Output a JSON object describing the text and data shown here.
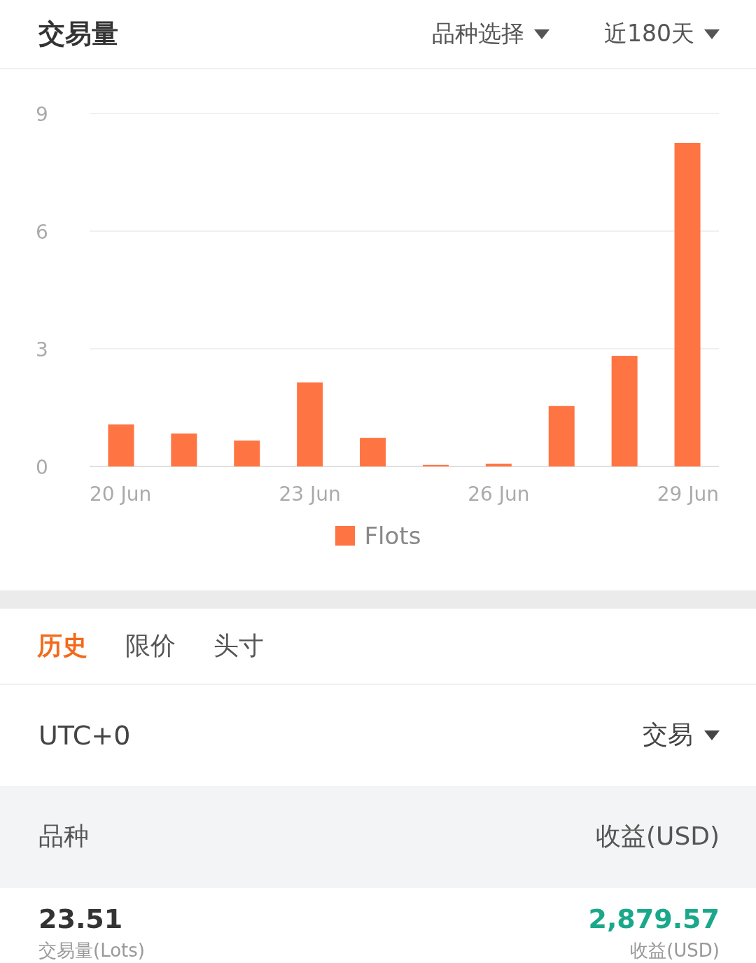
{
  "header": {
    "title": "交易量",
    "filters": [
      {
        "label": "品种选择"
      },
      {
        "label": "近180天"
      }
    ]
  },
  "chart": {
    "chart_data": {
      "type": "bar",
      "categories": [
        "20 Jun",
        null,
        null,
        "23 Jun",
        null,
        null,
        "26 Jun",
        null,
        null,
        "29 Jun"
      ],
      "series": [
        {
          "name": "Flots",
          "color": "#ff7443",
          "values": [
            1.07,
            0.84,
            0.66,
            2.14,
            0.73,
            0.04,
            0.07,
            1.54,
            2.82,
            8.25
          ]
        }
      ],
      "ylim": [
        0,
        9
      ],
      "yticks": [
        0,
        3,
        6,
        9
      ]
    }
  },
  "tabs": [
    {
      "label": "历史",
      "selected": true
    },
    {
      "label": "限价",
      "selected": false
    },
    {
      "label": "头寸",
      "selected": false
    }
  ],
  "filter_row": {
    "timezone": "UTC+0",
    "type_select": "交易"
  },
  "table": {
    "columns": [
      "品种",
      "收益(USD)"
    ],
    "rows": [
      {
        "volume": "23.51",
        "volume_label": "交易量(Lots)",
        "profit": "2,879.57",
        "profit_label": "收益(USD)"
      }
    ]
  }
}
